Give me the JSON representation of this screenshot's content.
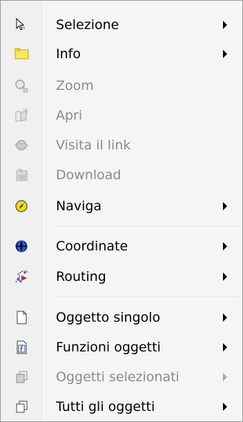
{
  "menu": {
    "items": [
      {
        "label": "Selezione",
        "icon": "cursor-icon",
        "enabled": true,
        "submenu": true
      },
      {
        "label": "Info",
        "icon": "info-panel-icon",
        "enabled": true,
        "submenu": true
      },
      {
        "label": "Zoom",
        "icon": "zoom-magnifier-icon",
        "enabled": false,
        "submenu": false
      },
      {
        "label": "Apri",
        "icon": "open-folder-icon",
        "enabled": false,
        "submenu": false
      },
      {
        "label": "Visita il link",
        "icon": "globe-link-icon",
        "enabled": false,
        "submenu": false
      },
      {
        "label": "Download",
        "icon": "download-icon",
        "enabled": false,
        "submenu": false
      },
      {
        "label": "Naviga",
        "icon": "compass-icon",
        "enabled": true,
        "submenu": true
      },
      {
        "label": "Coordinate",
        "icon": "coordinates-globe-icon",
        "enabled": true,
        "submenu": true
      },
      {
        "label": "Routing",
        "icon": "routing-icon",
        "enabled": true,
        "submenu": true
      },
      {
        "label": "Oggetto singolo",
        "icon": "single-object-icon",
        "enabled": true,
        "submenu": true
      },
      {
        "label": "Funzioni oggetti",
        "icon": "object-functions-icon",
        "enabled": true,
        "submenu": true
      },
      {
        "label": "Oggetti selezionati",
        "icon": "selected-objects-icon",
        "enabled": false,
        "submenu": true
      },
      {
        "label": "Tutti gli oggetti",
        "icon": "all-objects-icon",
        "enabled": true,
        "submenu": true
      }
    ]
  },
  "colors": {
    "menu_background": "#f5f5f5",
    "disabled_text": "#8a8a8a",
    "border": "#979797"
  }
}
